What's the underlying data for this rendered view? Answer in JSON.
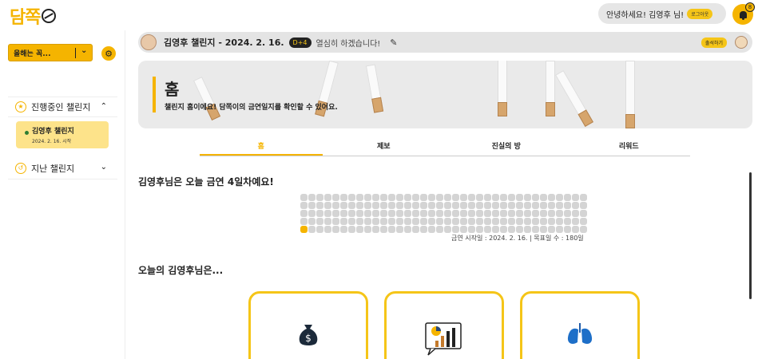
{
  "header": {
    "logo_text": "담쪽",
    "greeting": "안녕하세요! 김영후 님!",
    "logout_label": "로그아웃",
    "notification_count": "8"
  },
  "sidebar": {
    "select_value": "올해는 꼭...",
    "ongoing_label": "진행중인 챌린지",
    "ongoing_items": [
      {
        "title": "김영후 챌린지",
        "date": "2024. 2. 16. 시작"
      }
    ],
    "past_label": "지난 챌린지"
  },
  "challenge_bar": {
    "title": "김영후 챌린지 - 2024. 2. 16.",
    "dday": "D+4",
    "pledge": "열심히 하겠습니다!",
    "attend_label": "출석하기"
  },
  "hero": {
    "title": "홈",
    "subtitle": "챌린지 홈이에요! 담쪽이의 금연일지를 확인할 수 있어요."
  },
  "tabs": [
    {
      "label": "홈",
      "active": true
    },
    {
      "label": "제보",
      "active": false
    },
    {
      "label": "진실의 방",
      "active": false
    },
    {
      "label": "리워드",
      "active": false
    }
  ],
  "main": {
    "day_headline": "김영후님은 오늘 금연 4일차예요!",
    "grid_caption": "금연 시작일 : 2024. 2. 16. | 목표일 수 : 180일",
    "goal_days": 180,
    "completed_days": 1,
    "today_headline": "오늘의 김영후님은...",
    "cards": [
      {
        "icon": "money-bag-icon"
      },
      {
        "icon": "chart-icon"
      },
      {
        "icon": "lungs-icon"
      }
    ]
  },
  "colors": {
    "accent": "#f5b400",
    "accent_light": "#fde38a",
    "grid_empty": "#d4d4d4"
  }
}
